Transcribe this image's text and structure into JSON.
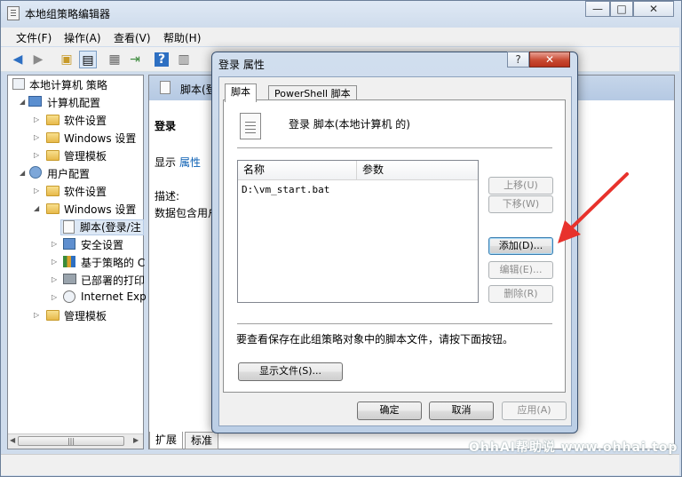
{
  "main_window": {
    "title": "本地组策略编辑器",
    "caption_minimize": "—",
    "caption_maximize": "□",
    "caption_close": "✕"
  },
  "menu": {
    "items": [
      "文件(F)",
      "操作(A)",
      "查看(V)",
      "帮助(H)"
    ]
  },
  "toolbar": {
    "icons": [
      "back-arrow-icon",
      "forward-arrow-icon",
      "up-folder-icon",
      "show-hide-tree-icon",
      "properties-icon",
      "export-list-icon",
      "help-icon",
      "console-view-icon"
    ]
  },
  "tree": {
    "root": "本地计算机 策略",
    "computer_config": "计算机配置",
    "computer_software": "软件设置",
    "computer_windows": "Windows 设置",
    "computer_admin": "管理模板",
    "user_config": "用户配置",
    "user_software": "软件设置",
    "user_windows": "Windows 设置",
    "scripts": "脚本(登录/注",
    "security": "安全设置",
    "policy_qos": "基于策略的 C",
    "deployed_printers": "已部署的打印",
    "ie": "Internet Exp",
    "user_admin": "管理模板",
    "scroll_grip": "|||"
  },
  "right_pane": {
    "header": "脚本(登",
    "section_title": "登录",
    "show_label": "显示",
    "properties_link": "属性",
    "desc_label": "描述:",
    "desc_text": "数据包含用户",
    "tabs": [
      "扩展",
      "标准"
    ]
  },
  "dialog": {
    "title": "登录 属性",
    "help_glyph": "?",
    "close_glyph": "✕",
    "tabs": [
      "脚本",
      "PowerShell 脚本"
    ],
    "heading": "登录 脚本(本地计算机 的)",
    "columns": [
      "名称",
      "参数"
    ],
    "rows": [
      {
        "name": "D:\\vm_start.bat",
        "params": ""
      }
    ],
    "btn_up": "上移(U)",
    "btn_down": "下移(W)",
    "btn_add": "添加(D)...",
    "btn_edit": "编辑(E)...",
    "btn_delete": "删除(R)",
    "info_text": "要查看保存在此组策略对象中的脚本文件，请按下面按钮。",
    "btn_show_files": "显示文件(S)...",
    "btn_ok": "确定",
    "btn_cancel": "取消",
    "btn_apply": "应用(A)"
  },
  "watermark": "OhhAI帮助说 www.ohhai.top",
  "colors": {
    "annotation_arrow": "#e8322c",
    "dialog_frame": "#bccfe6",
    "close_button": "#c84a32"
  }
}
